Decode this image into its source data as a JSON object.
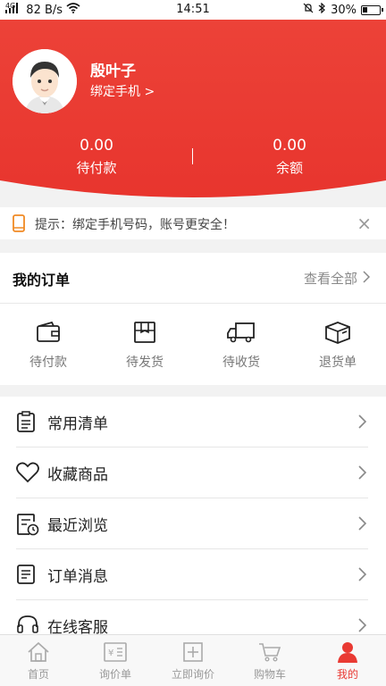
{
  "status_bar": {
    "network": "4G",
    "speed": "82 B/s",
    "time": "14:51",
    "battery": "30%"
  },
  "profile": {
    "name": "殷叶子",
    "bind_phone": "绑定手机 >"
  },
  "stats": [
    {
      "value": "0.00",
      "label": "待付款"
    },
    {
      "value": "0.00",
      "label": "余额"
    }
  ],
  "tip": {
    "text": "提示：绑定手机号码，账号更安全！",
    "close": "×"
  },
  "orders": {
    "title": "我的订单",
    "view_all": "查看全部",
    "items": [
      {
        "label": "待付款",
        "icon": "wallet-icon"
      },
      {
        "label": "待发货",
        "icon": "package-icon"
      },
      {
        "label": "待收货",
        "icon": "truck-icon"
      },
      {
        "label": "退货单",
        "icon": "box-icon"
      }
    ]
  },
  "menu": [
    {
      "label": "常用清单",
      "icon": "list-icon"
    },
    {
      "label": "收藏商品",
      "icon": "heart-icon"
    },
    {
      "label": "最近浏览",
      "icon": "history-icon"
    },
    {
      "label": "订单消息",
      "icon": "message-icon"
    },
    {
      "label": "在线客服",
      "icon": "headset-icon"
    }
  ],
  "tabbar": [
    {
      "label": "首页",
      "icon": "home-icon"
    },
    {
      "label": "询价单",
      "icon": "quote-icon"
    },
    {
      "label": "立即询价",
      "icon": "add-icon"
    },
    {
      "label": "购物车",
      "icon": "cart-icon"
    },
    {
      "label": "我的",
      "icon": "user-icon",
      "active": true
    }
  ],
  "colors": {
    "brand_red": "#e93a33",
    "active_tab": "#e93a33"
  }
}
